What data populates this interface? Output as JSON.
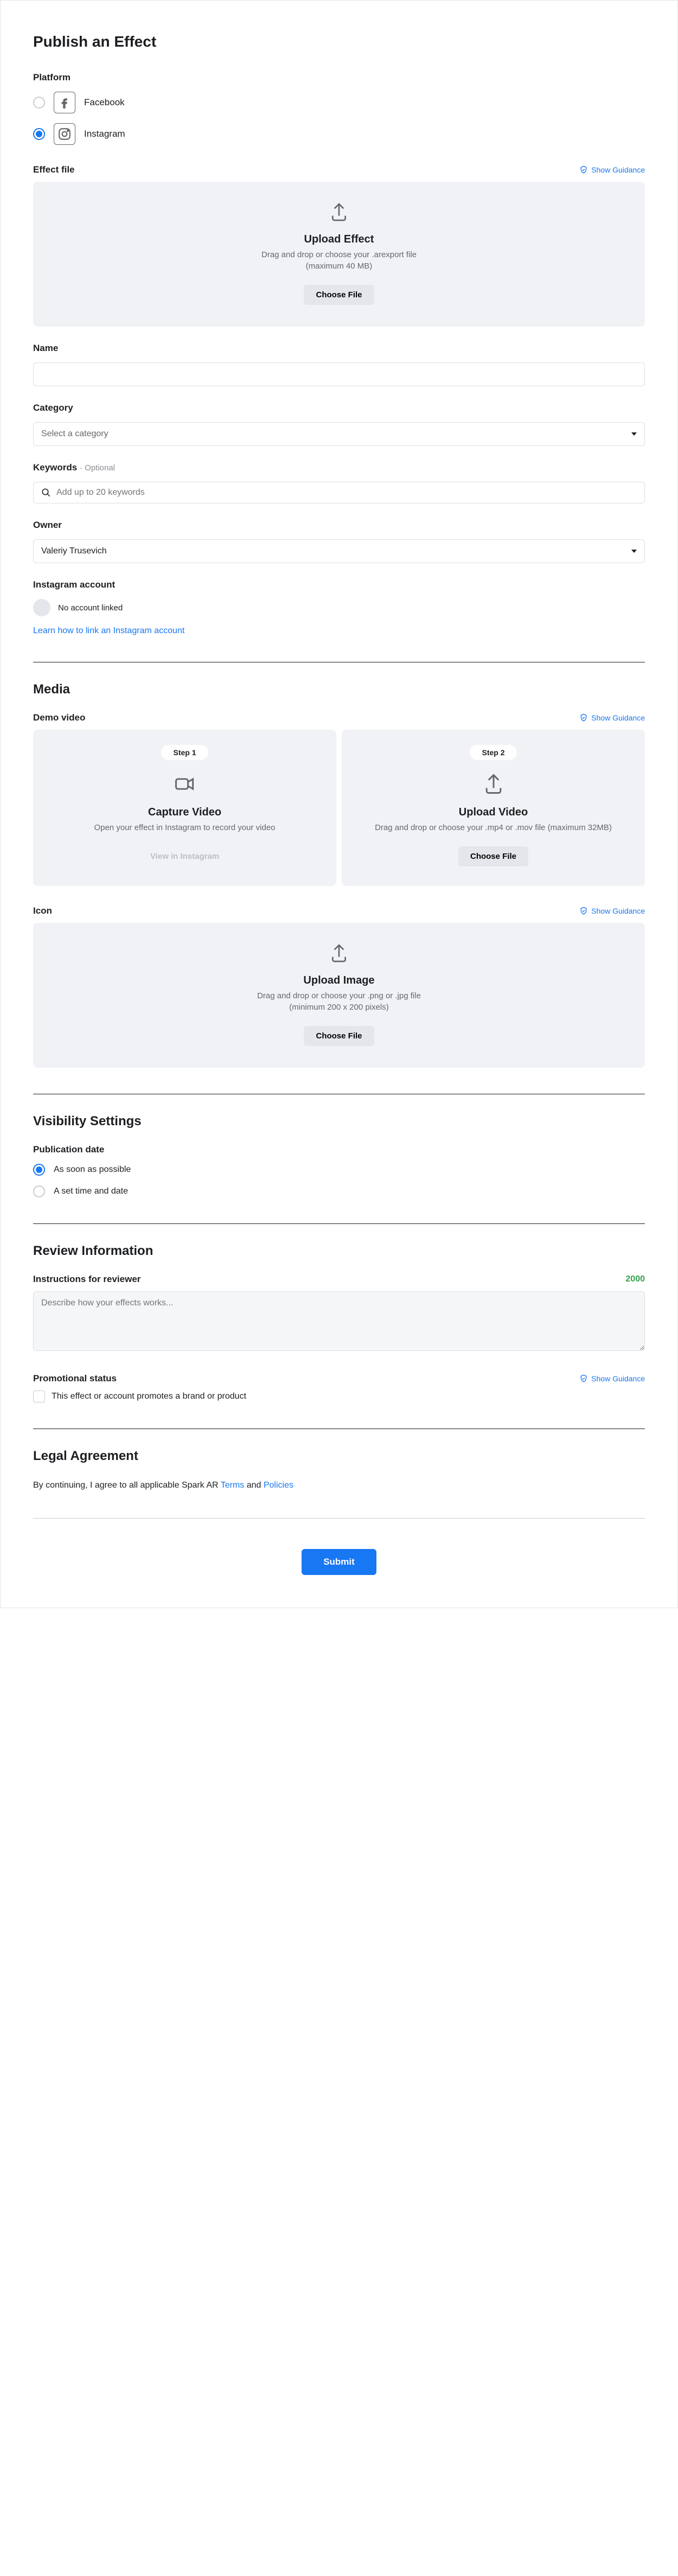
{
  "page_title": "Publish an Effect",
  "platform": {
    "label": "Platform",
    "options": [
      {
        "name": "Facebook",
        "selected": false
      },
      {
        "name": "Instagram",
        "selected": true
      }
    ]
  },
  "effect_file": {
    "label": "Effect file",
    "guidance_label": "Show Guidance",
    "upload_title": "Upload Effect",
    "upload_desc_line1": "Drag and drop or choose your .arexport file",
    "upload_desc_line2": "(maximum 40 MB)",
    "choose_file_label": "Choose File"
  },
  "name": {
    "label": "Name",
    "value": ""
  },
  "category": {
    "label": "Category",
    "placeholder": "Select a category"
  },
  "keywords": {
    "label": "Keywords",
    "optional_label": "· Optional",
    "placeholder": "Add up to 20 keywords"
  },
  "owner": {
    "label": "Owner",
    "value": "Valeriy Trusevich"
  },
  "instagram_account": {
    "label": "Instagram account",
    "status": "No account linked",
    "link_help": "Learn how to link an Instagram account"
  },
  "media": {
    "section_title": "Media",
    "demo_video": {
      "label": "Demo video",
      "guidance_label": "Show Guidance",
      "step1": {
        "pill": "Step 1",
        "title": "Capture Video",
        "desc": "Open your effect in Instagram to record your video",
        "button": "View in Instagram"
      },
      "step2": {
        "pill": "Step 2",
        "title": "Upload Video",
        "desc": "Drag and drop or choose your .mp4 or .mov file (maximum 32MB)",
        "button": "Choose File"
      }
    },
    "icon": {
      "label": "Icon",
      "guidance_label": "Show Guidance",
      "upload_title": "Upload Image",
      "upload_desc_line1": "Drag and drop or choose your .png or .jpg file",
      "upload_desc_line2": "(minimum 200 x 200 pixels)",
      "button": "Choose File"
    }
  },
  "visibility": {
    "section_title": "Visibility Settings",
    "pub_date_label": "Publication date",
    "options": [
      {
        "label": "As soon as possible",
        "selected": true
      },
      {
        "label": "A set time and date",
        "selected": false
      }
    ]
  },
  "review": {
    "section_title": "Review Information",
    "instructions_label": "Instructions for reviewer",
    "char_count": "2000",
    "placeholder": "Describe how your effects works...",
    "promo_label": "Promotional status",
    "promo_guidance": "Show Guidance",
    "promo_checkbox_label": "This effect or account promotes a brand or product"
  },
  "legal": {
    "section_title": "Legal Agreement",
    "prefix": "By continuing, I agree to all applicable Spark AR ",
    "terms": "Terms",
    "and": " and ",
    "policies": "Policies"
  },
  "submit_label": "Submit"
}
